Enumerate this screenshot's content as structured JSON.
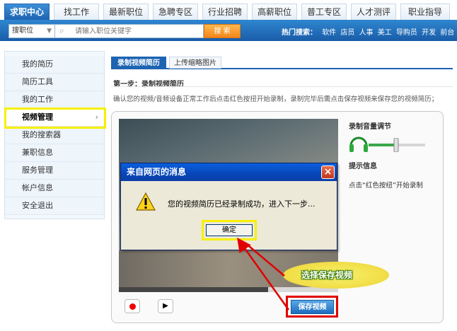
{
  "nav": {
    "tabs": [
      "求职中心",
      "找工作",
      "最新职位",
      "急聘专区",
      "行业招聘",
      "高薪职位",
      "普工专区",
      "人才测评",
      "职业指导"
    ]
  },
  "search": {
    "type_label": "搜职位",
    "placeholder": "请输入职位关键字",
    "button": "搜 索",
    "hot_label": "热门搜索：",
    "hot_keywords": [
      "软件",
      "店员",
      "人事",
      "美工",
      "导购员",
      "开发",
      "前台"
    ]
  },
  "sidebar": {
    "items": [
      "我的简历",
      "简历工具",
      "我的工作",
      "视频管理",
      "我的搜索器",
      "兼职信息",
      "服务管理",
      "帐户信息",
      "安全退出"
    ],
    "selected": "视频管理"
  },
  "content": {
    "tabs": [
      "录制视频简历",
      "上传缩略图片"
    ],
    "step_title": "第一步：录制视频简历",
    "description": "确认您的视频/音频设备正常工作后点击红色按扭开始录制，录制完毕后需点击保存视频来保存您的视频简历；",
    "volume_title": "录制音量调节",
    "hint_title": "提示信息",
    "hint_text": "点击“红色按纽”开始录制",
    "save_button": "保存视频",
    "progress": 0.68
  },
  "dialog": {
    "title": "来自网页的消息",
    "message": "您的视频简历已经录制成功，进入下一步...",
    "ok_button": "确定"
  },
  "annotation": {
    "callout": "选择保存视频"
  },
  "colors": {
    "nav_blue": "#1d64b2",
    "highlight_yellow": "#f7f000",
    "highlight_red": "#e10000"
  }
}
